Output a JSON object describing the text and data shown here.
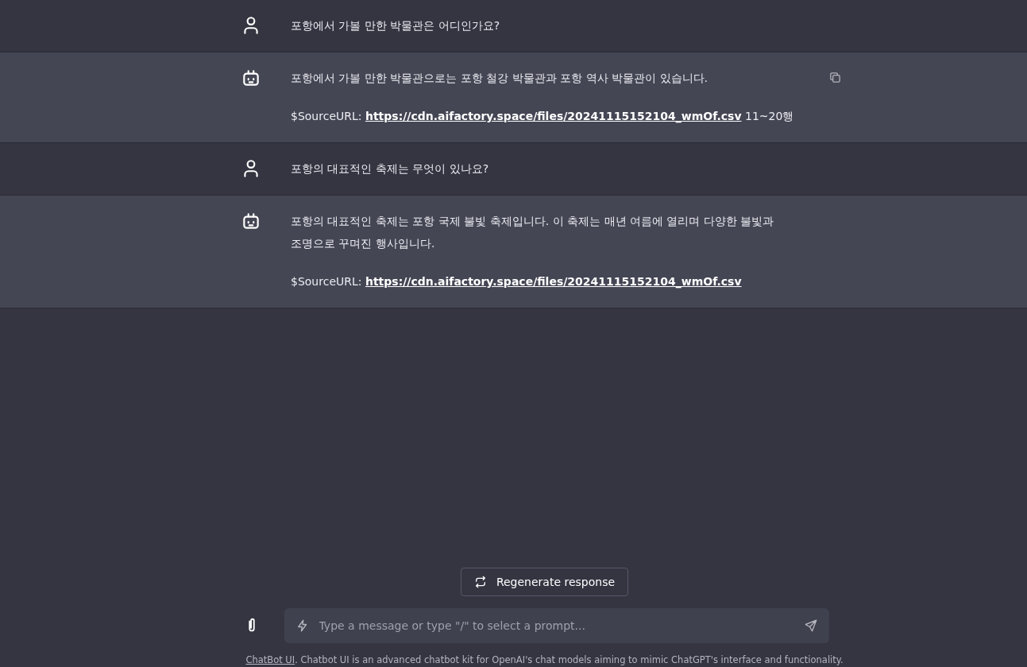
{
  "messages": [
    {
      "kind": "user",
      "paragraphs": [
        {
          "text": "포항에서 가볼 만한 박물관은 어디인가요?"
        }
      ],
      "copy_visible": false
    },
    {
      "kind": "assistant",
      "paragraphs": [
        {
          "text": "포항에서 가볼 만한 박물관으로는 포항 철강 박물관과 포항 역사 박물관이 있습니다."
        },
        {
          "label": "$SourceURL:",
          "link": "https://cdn.aifactory.space/files/20241115152104_wmOf.csv",
          "suffix": "11~20행"
        }
      ],
      "copy_visible": true
    },
    {
      "kind": "user",
      "paragraphs": [
        {
          "text": "포항의 대표적인 축제는 무엇이 있나요?"
        }
      ],
      "copy_visible": false
    },
    {
      "kind": "assistant",
      "paragraphs": [
        {
          "text": "포항의 대표적인 축제는 포항 국제 불빛 축제입니다. 이 축제는 매년 여름에 열리며 다양한 불빛과 조명으로 꾸며진 행사입니다."
        },
        {
          "label": "$SourceURL:",
          "link": "https://cdn.aifactory.space/files/20241115152104_wmOf.csv"
        }
      ],
      "copy_visible": false
    }
  ],
  "regenerate_button": "Regenerate response",
  "input": {
    "placeholder": "Type a message or type \"/\" to select a prompt..."
  },
  "footer": {
    "link": "ChatBot UI",
    "text": ". Chatbot UI is an advanced chatbot kit for OpenAI's chat models aiming to mimic ChatGPT's interface and functionality."
  }
}
